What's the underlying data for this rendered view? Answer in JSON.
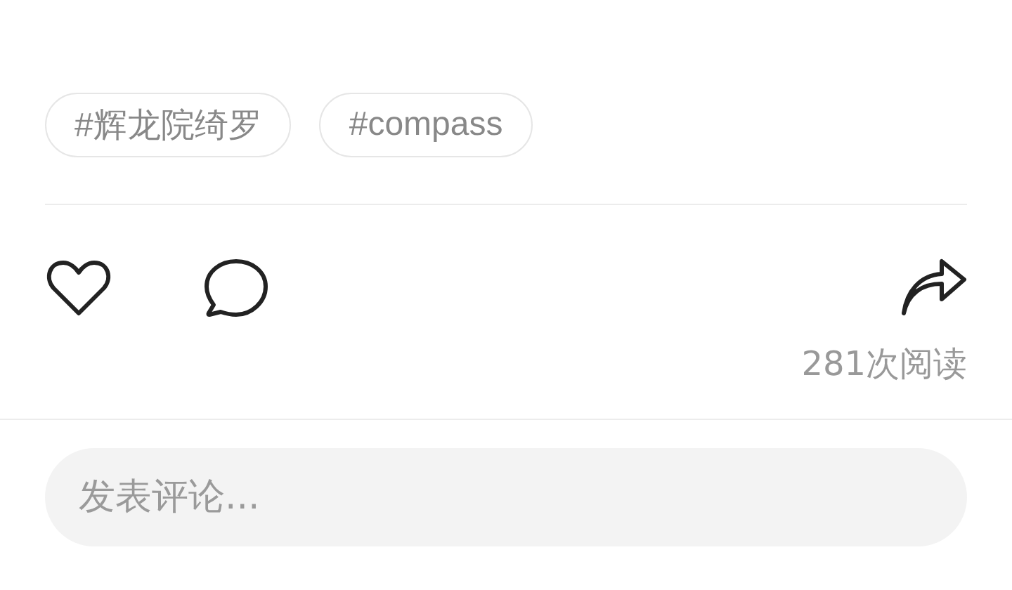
{
  "tags": [
    "#辉龙院绮罗",
    "#compass"
  ],
  "views": "281次阅读",
  "comment_field": {
    "placeholder": "发表评论..."
  }
}
